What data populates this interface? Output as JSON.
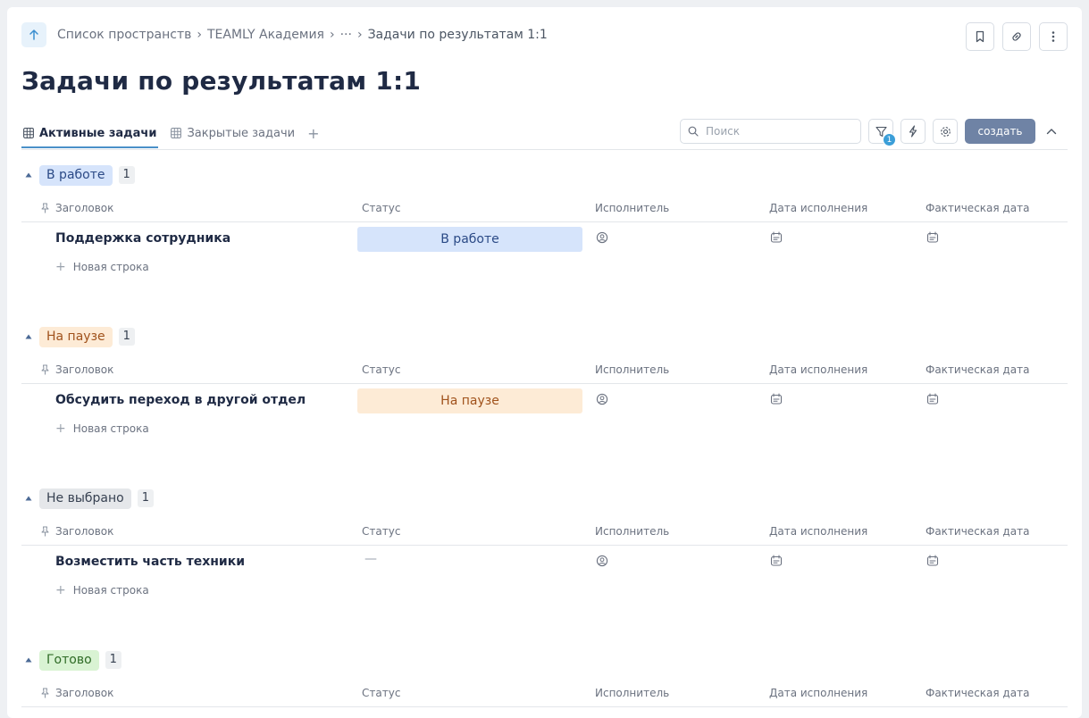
{
  "breadcrumb": {
    "items": [
      "Список пространств",
      "TEAMLY Академия",
      "···",
      "Задачи по результатам 1:1"
    ]
  },
  "page_title": "Задачи по результатам 1:1",
  "tabs": [
    {
      "label": "Активные задачи",
      "active": true
    },
    {
      "label": "Закрытые задачи",
      "active": false
    }
  ],
  "toolbar": {
    "search_placeholder": "Поиск",
    "filter_count": "1",
    "create_label": "создать"
  },
  "columns": {
    "title": "Заголовок",
    "status": "Статус",
    "assignee": "Исполнитель",
    "due_date": "Дата исполнения",
    "actual_date": "Фактическая дата"
  },
  "new_row_label": "Новая строка",
  "groups": [
    {
      "name": "В работе",
      "count": "1",
      "pill_bg": "#d6e4fb",
      "pill_fg": "#2b4a86",
      "rows": [
        {
          "title": "Поддержка сотрудника",
          "status": "В работе"
        }
      ]
    },
    {
      "name": "На паузе",
      "count": "1",
      "pill_bg": "#fdebd6",
      "pill_fg": "#a0521c",
      "rows": [
        {
          "title": "Обсудить переход в другой отдел",
          "status": "На паузе"
        }
      ]
    },
    {
      "name": "Не выбрано",
      "count": "1",
      "pill_bg": "#e5e7ea",
      "pill_fg": "#374151",
      "rows": [
        {
          "title": "Возместить часть техники",
          "status": "—"
        }
      ]
    },
    {
      "name": "Готово",
      "count": "1",
      "pill_bg": "#d9f3d3",
      "pill_fg": "#2f6b26",
      "rows": []
    }
  ],
  "colors": {
    "accent": "#4a90c8",
    "create_button": "#6f83a5",
    "title_text": "#1f2a44"
  },
  "icons": [
    "arrow-up-icon",
    "bookmark-icon",
    "link-icon",
    "more-vertical-icon",
    "table-icon",
    "search-icon",
    "filter-icon",
    "lightning-icon",
    "gear-icon",
    "chevron-up-icon",
    "caret-up-icon",
    "pin-icon",
    "user-icon",
    "calendar-icon",
    "plus-icon"
  ]
}
